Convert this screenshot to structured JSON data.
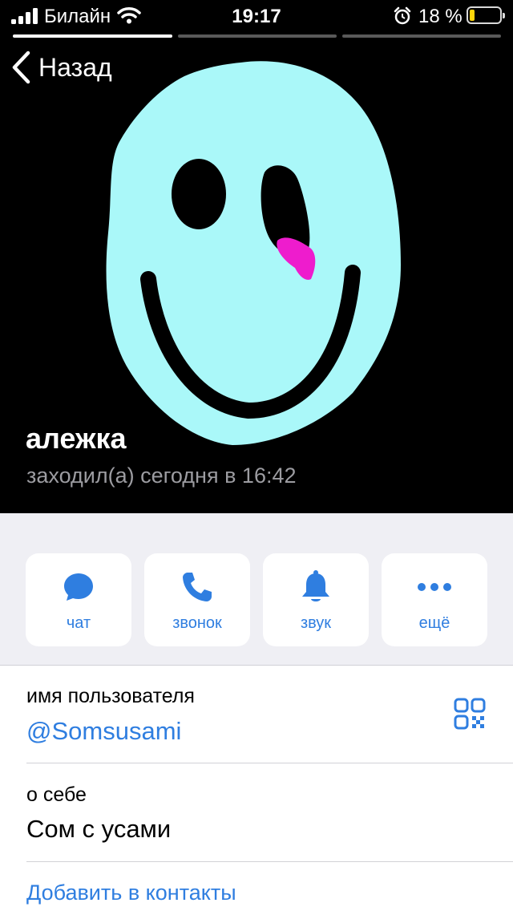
{
  "status_bar": {
    "carrier": "Билайн",
    "time": "19:17",
    "battery_percent_text": "18 %",
    "battery_level": 0.18,
    "battery_color": "#ffd60a"
  },
  "story_progress": {
    "segments": 3,
    "active_index": 0
  },
  "nav": {
    "back_label": "Назад",
    "back_icon": "chevron-left-icon"
  },
  "profile": {
    "name": "алежка",
    "last_seen": "заходил(а) сегодня в 16:42",
    "avatar_colors": {
      "face": "#aaf8f9",
      "features": "#000000",
      "accent": "#ee1ccd",
      "background": "#000000"
    }
  },
  "actions": [
    {
      "label": "чат",
      "icon": "chat-bubble-icon"
    },
    {
      "label": "звонок",
      "icon": "phone-icon"
    },
    {
      "label": "звук",
      "icon": "bell-icon"
    },
    {
      "label": "ещё",
      "icon": "more-dots-icon"
    }
  ],
  "info": {
    "username_label": "имя пользователя",
    "username": "@Somsusami",
    "bio_label": "о себе",
    "bio": "Сом с усами",
    "add_contact": "Добавить в контакты",
    "qr_icon": "qr-code-icon"
  },
  "colors": {
    "accent": "#2f7ee0",
    "grouped_background": "#efeff4",
    "separator": "#d1d1d6"
  }
}
